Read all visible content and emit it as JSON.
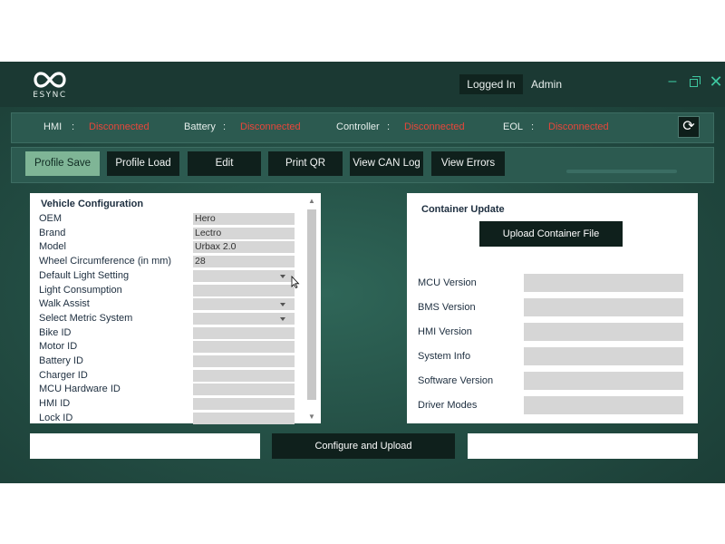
{
  "app": {
    "logo_text": "ESYNC",
    "login_status": "Logged In",
    "user": "Admin"
  },
  "status": {
    "hmi_label": "HMI",
    "hmi_value": "Disconnected",
    "battery_label": "Battery",
    "battery_value": "Disconnected",
    "controller_label": "Controller",
    "controller_value": "Disconnected",
    "eol_label": "EOL",
    "eol_value": "Disconnected",
    "separator": ":",
    "error_color": "#e8463a"
  },
  "toolbar": {
    "profile_save": "Profile Save",
    "profile_load": "Profile Load",
    "edit": "Edit",
    "print_qr": "Print QR",
    "view_can_log": "View CAN Log",
    "view_errors": "View Errors"
  },
  "vehicle_config": {
    "title": "Vehicle Configuration",
    "rows": [
      {
        "label": "OEM",
        "value": "Hero",
        "dropdown": false
      },
      {
        "label": "Brand",
        "value": "Lectro",
        "dropdown": false
      },
      {
        "label": "Model",
        "value": "Urbax 2.0",
        "dropdown": false
      },
      {
        "label": "Wheel Circumference (in mm)",
        "value": "28",
        "dropdown": false
      },
      {
        "label": "Default Light Setting",
        "value": "",
        "dropdown": true
      },
      {
        "label": "Light Consumption",
        "value": "",
        "dropdown": false
      },
      {
        "label": "Walk Assist",
        "value": "",
        "dropdown": true
      },
      {
        "label": "Select Metric System",
        "value": "",
        "dropdown": true
      },
      {
        "label": "Bike ID",
        "value": "",
        "dropdown": false
      },
      {
        "label": "Motor ID",
        "value": "",
        "dropdown": false
      },
      {
        "label": "Battery ID",
        "value": "",
        "dropdown": false
      },
      {
        "label": "Charger ID",
        "value": "",
        "dropdown": false
      },
      {
        "label": "MCU Hardware ID",
        "value": "",
        "dropdown": false
      },
      {
        "label": "HMI ID",
        "value": "",
        "dropdown": false
      },
      {
        "label": "Lock ID",
        "value": "",
        "dropdown": false
      }
    ]
  },
  "container_update": {
    "title": "Container Update",
    "upload_button": "Upload Container File",
    "fields": [
      {
        "label": "MCU Version",
        "value": ""
      },
      {
        "label": "BMS Version",
        "value": ""
      },
      {
        "label": "HMI Version",
        "value": ""
      },
      {
        "label": "System Info",
        "value": ""
      },
      {
        "label": "Software Version",
        "value": ""
      },
      {
        "label": "Driver Modes",
        "value": ""
      }
    ]
  },
  "footer": {
    "configure_button": "Configure and Upload",
    "left_field": "",
    "right_field": ""
  },
  "icons": {
    "logo": "infinity-logo-icon",
    "minimize": "minimize-icon",
    "restore": "restore-icon",
    "close": "close-icon",
    "refresh": "refresh-icon",
    "dropdown": "chevron-down-icon",
    "cursor": "mouse-pointer-icon"
  },
  "colors": {
    "accent": "#3ec7a0",
    "active_button": "#7fb596",
    "dark_button": "#0f201c"
  }
}
